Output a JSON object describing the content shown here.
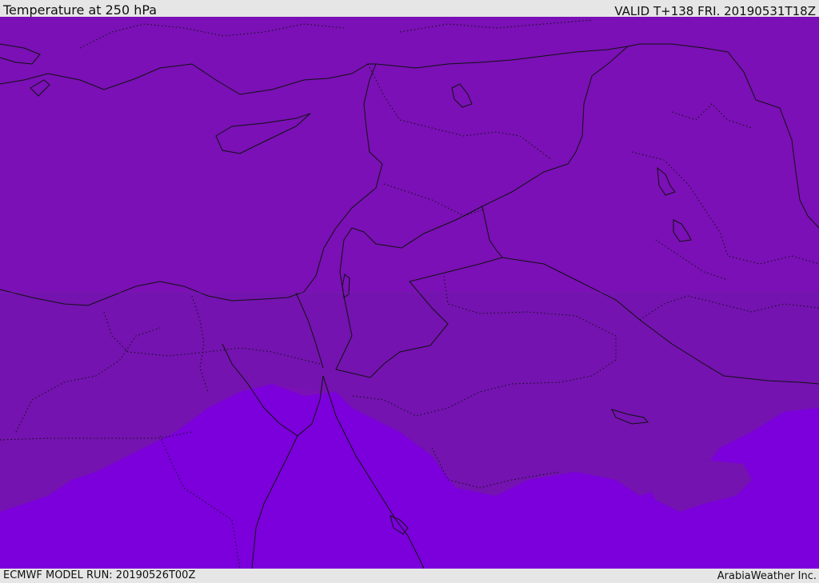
{
  "header": {
    "title": "Temperature at 250 hPa",
    "valid": "VALID T+138 FRI. 20190531T18Z"
  },
  "footer": {
    "model_run": "ECMWF MODEL RUN: 20190526T00Z",
    "credit": "ArabiaWeather Inc."
  },
  "colors": {
    "background_band": "#7a10b5",
    "mid_band": "#7413b0",
    "south_band": "#7b00db",
    "boundaries": "#111111"
  },
  "map": {
    "region": "Eastern Mediterranean and Middle East",
    "icons": [
      "country-border-lines",
      "coastline-lines",
      "province-dotted-lines",
      "temperature-contour-fills"
    ]
  }
}
